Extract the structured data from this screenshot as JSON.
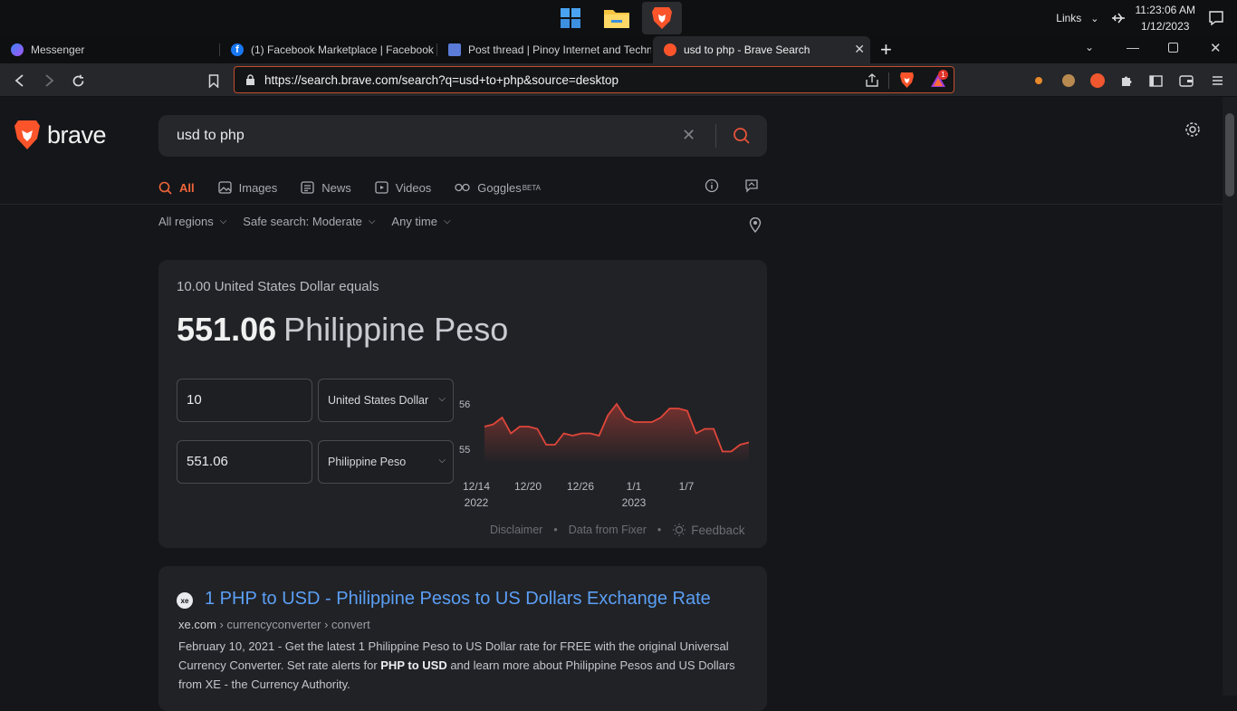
{
  "taskbar": {
    "apps": [
      "windows-start",
      "file-explorer",
      "brave-browser"
    ],
    "links_label": "Links",
    "time": "11:23:06 AM",
    "date": "1/12/2023"
  },
  "tabs": [
    {
      "title": "Messenger",
      "icon": "messenger-icon",
      "active": false
    },
    {
      "title": "(1) Facebook Marketplace | Facebook",
      "icon": "facebook-icon",
      "active": false
    },
    {
      "title": "Post thread | Pinoy Internet and Techn",
      "icon": "pinoy-tech-icon",
      "active": false
    },
    {
      "title": "usd to php - Brave Search",
      "icon": "brave-search-icon",
      "active": true
    }
  ],
  "toolbar": {
    "url": "https://search.brave.com/search?q=usd+to+php&source=desktop",
    "rewards_badge": "1"
  },
  "brand": "brave",
  "search": {
    "query": "usd to php"
  },
  "filters": [
    {
      "label": "All",
      "icon": "search-icon",
      "active": true
    },
    {
      "label": "Images",
      "icon": "image-icon",
      "active": false
    },
    {
      "label": "News",
      "icon": "news-icon",
      "active": false
    },
    {
      "label": "Videos",
      "icon": "video-icon",
      "active": false
    },
    {
      "label": "Goggles",
      "sup": "BETA",
      "icon": "goggles-icon",
      "active": false
    }
  ],
  "dropdowns": {
    "region": "All regions",
    "safe_search": "Safe search: Moderate",
    "time": "Any time"
  },
  "converter": {
    "equals_text": "10.00 United States Dollar equals",
    "result_value": "551.06",
    "result_unit": "Philippine Peso",
    "from_amount": "10",
    "from_currency": "United States Dollar",
    "to_amount": "551.06",
    "to_currency": "Philippine Peso",
    "footer": {
      "disclaimer": "Disclaimer",
      "data_source": "Data from Fixer",
      "feedback": "Feedback"
    }
  },
  "chart_data": {
    "type": "area",
    "title": "",
    "xlabel": "",
    "ylabel": "",
    "y_ticks": [
      "56",
      "55"
    ],
    "x_ticks": [
      {
        "label": "12/14",
        "sub": "2022"
      },
      {
        "label": "12/20",
        "sub": ""
      },
      {
        "label": "12/26",
        "sub": ""
      },
      {
        "label": "1/1",
        "sub": "2023"
      },
      {
        "label": "1/7",
        "sub": ""
      }
    ],
    "ylim": [
      54.7,
      56.3
    ],
    "color": "#e0463a",
    "values": [
      55.5,
      55.55,
      55.7,
      55.35,
      55.5,
      55.5,
      55.45,
      55.1,
      55.1,
      55.35,
      55.3,
      55.35,
      55.35,
      55.3,
      55.75,
      56.0,
      55.7,
      55.6,
      55.6,
      55.6,
      55.7,
      55.9,
      55.9,
      55.85,
      55.35,
      55.45,
      55.45,
      54.95,
      54.95,
      55.1,
      55.15
    ]
  },
  "results": [
    {
      "favicon_text": "xe",
      "title": "1 PHP to USD - Philippine Pesos to US Dollars Exchange Rate",
      "domain": "xe.com",
      "path": " › currencyconverter › convert",
      "desc_1": "February 10, 2021 - Get the latest 1 Philippine Peso to US Dollar rate for FREE with the original Universal Currency Converter. Set rate alerts for ",
      "desc_bold_1": "PHP to USD",
      "desc_2": " and learn more about Philippine Pesos and US Dollars from XE - the Currency Authority."
    }
  ]
}
